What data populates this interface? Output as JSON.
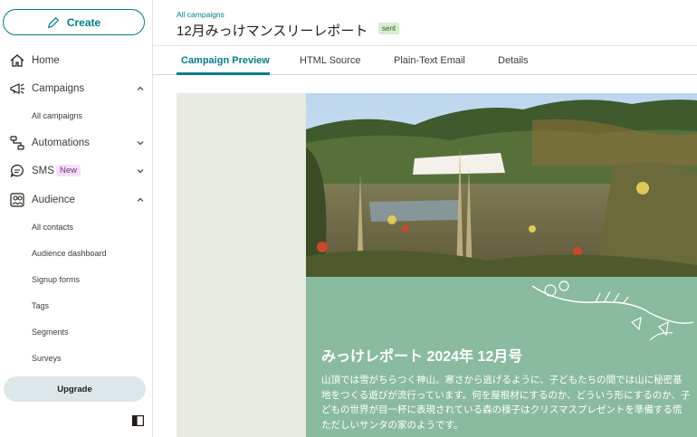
{
  "sidebar": {
    "create_label": "Create",
    "items": [
      {
        "label": "Home"
      },
      {
        "label": "Campaigns"
      },
      {
        "label": "Automations"
      },
      {
        "label": "SMS",
        "badge": "New"
      },
      {
        "label": "Audience"
      }
    ],
    "campaigns_sub": [
      "All campaigns"
    ],
    "audience_sub": [
      "All contacts",
      "Audience dashboard",
      "Signup forms",
      "Tags",
      "Segments",
      "Surveys"
    ],
    "upgrade_label": "Upgrade"
  },
  "header": {
    "breadcrumb": "All campaigns",
    "title": "12月みっけマンスリーレポート",
    "status": "sent"
  },
  "tabs": [
    "Campaign Preview",
    "HTML Source",
    "Plain-Text Email",
    "Details"
  ],
  "email": {
    "heading": "みっけレポート 2024年 12月号",
    "body": "山頂では雪がちらつく神山。寒さから逃げるように、子どもたちの間では山に秘密基地をつくる遊びが流行っています。何を屋根材にするのか、どういう形にするのか、子どもの世界が目一杯に表現されている森の様子はクリスマスプレゼントを準備する慌ただしいサンタの家のようです。"
  },
  "colors": {
    "accent": "#017e89",
    "panel_green": "#8abba1",
    "panel_gray": "#e8eae4",
    "sent_badge": "#d9ecd0",
    "new_badge": "#f4e0f6"
  }
}
